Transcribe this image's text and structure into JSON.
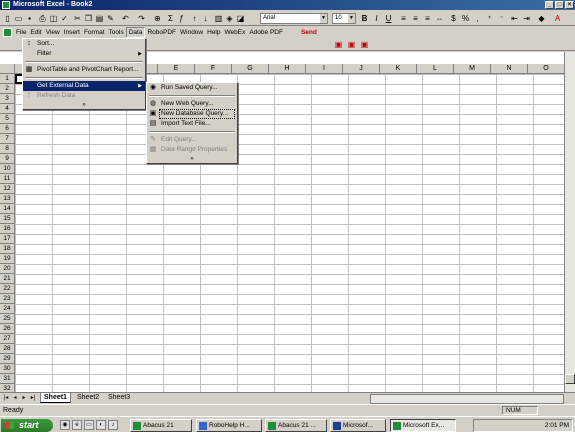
{
  "window": {
    "title": "Microsoft Excel - Book2",
    "min": "_",
    "max": "□",
    "close": "×"
  },
  "menubar": [
    "File",
    "Edit",
    "View",
    "Insert",
    "Format",
    "Tools",
    "Data",
    "RoboPDF",
    "Window",
    "Help",
    "WebEx",
    "Adobe PDF"
  ],
  "send_label": "Send",
  "font": {
    "name": "Arial",
    "size": "10"
  },
  "column_headers": [
    "E",
    "F",
    "G",
    "H",
    "I",
    "J",
    "K",
    "L",
    "M",
    "N",
    "O"
  ],
  "row_headers": [
    "1",
    "2",
    "3",
    "4",
    "5",
    "6",
    "7",
    "8",
    "9",
    "10",
    "11",
    "12",
    "13",
    "14",
    "15",
    "16",
    "17",
    "18",
    "19",
    "20",
    "21",
    "22",
    "23",
    "24",
    "25",
    "26",
    "27",
    "28",
    "29",
    "30",
    "31",
    "32"
  ],
  "data_menu": {
    "items": [
      {
        "label": "Sort...",
        "icon": "sort-icon"
      },
      {
        "label": "Filter",
        "submenu": true
      },
      {
        "label": "PivotTable and PivotChart Report...",
        "icon": "pivot-icon"
      },
      {
        "label": "Get External Data",
        "submenu": true,
        "highlighted": true
      },
      {
        "label": "Refresh Data",
        "disabled": true,
        "icon": "refresh-icon"
      }
    ],
    "more": "»"
  },
  "external_submenu": {
    "items": [
      {
        "label": "Run Saved Query..."
      },
      {
        "label": "New Web Query..."
      },
      {
        "label": "New Database Query..."
      },
      {
        "label": "Import Text File..."
      },
      {
        "label": "Edit Query...",
        "disabled": true
      },
      {
        "label": "Data Range Properties",
        "disabled": true
      }
    ],
    "more": "»"
  },
  "sheet_tabs": [
    "Sheet1",
    "Sheet2",
    "Sheet3"
  ],
  "status": {
    "text": "Ready",
    "num": "NUM"
  },
  "taskbar": {
    "start": "start",
    "buttons": [
      "Abacus 21",
      "RoboHelp H...",
      "Abacus 21 ...",
      "Microsof...",
      "Microsoft Ex..."
    ],
    "clock": "2:01 PM"
  }
}
